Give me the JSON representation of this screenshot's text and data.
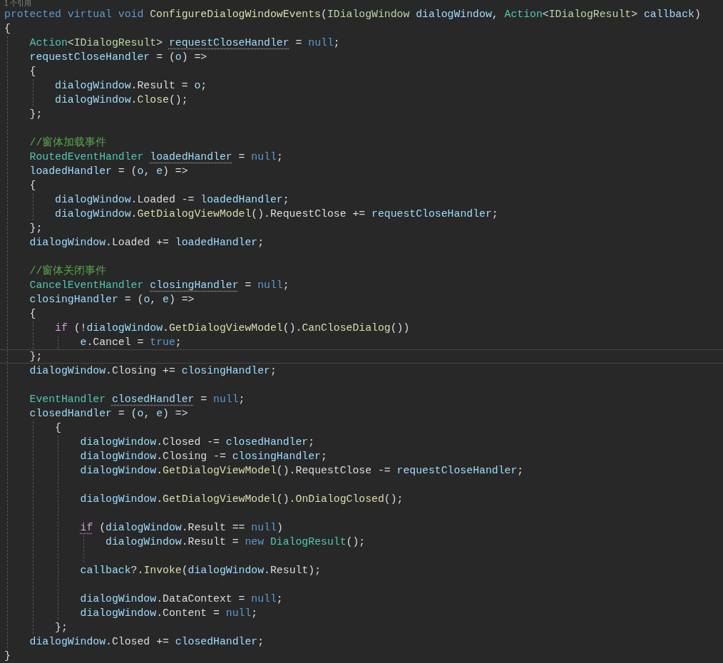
{
  "codelens": "1 个引用",
  "lines": [
    {
      "kind": "code",
      "current": false,
      "tokens": [
        {
          "kind": "kw",
          "text": "protected virtual void "
        },
        {
          "kind": "method",
          "text": "ConfigureDialogWindowEvents"
        },
        {
          "kind": "plain",
          "text": "("
        },
        {
          "kind": "iface",
          "text": "IDialogWindow "
        },
        {
          "kind": "var",
          "text": "dialogWindow"
        },
        {
          "kind": "plain",
          "text": ", "
        },
        {
          "kind": "type",
          "text": "Action"
        },
        {
          "kind": "plain",
          "text": "<"
        },
        {
          "kind": "iface",
          "text": "IDialogResult"
        },
        {
          "kind": "plain",
          "text": "> "
        },
        {
          "kind": "var",
          "text": "callback"
        },
        {
          "kind": "plain",
          "text": ")"
        }
      ]
    },
    {
      "kind": "code",
      "current": false,
      "tokens": [
        {
          "kind": "plain",
          "text": "{"
        }
      ]
    },
    {
      "kind": "code",
      "current": false,
      "tokens": [
        {
          "kind": "type",
          "text": "    Action"
        },
        {
          "kind": "plain",
          "text": "<"
        },
        {
          "kind": "iface",
          "text": "IDialogResult"
        },
        {
          "kind": "plain",
          "text": "> "
        },
        {
          "kind": "var",
          "text": "requestCloseHandler",
          "hint": true
        },
        {
          "kind": "plain",
          "text": " = "
        },
        {
          "kind": "kw",
          "text": "null"
        },
        {
          "kind": "plain",
          "text": ";"
        }
      ]
    },
    {
      "kind": "code",
      "current": false,
      "tokens": [
        {
          "kind": "var",
          "text": "    requestCloseHandler"
        },
        {
          "kind": "plain",
          "text": " = ("
        },
        {
          "kind": "var",
          "text": "o"
        },
        {
          "kind": "plain",
          "text": ") =>"
        }
      ]
    },
    {
      "kind": "code",
      "current": false,
      "tokens": [
        {
          "kind": "plain",
          "text": "    {"
        }
      ]
    },
    {
      "kind": "code",
      "current": false,
      "tokens": [
        {
          "kind": "var",
          "text": "        dialogWindow"
        },
        {
          "kind": "plain",
          "text": ".Result = "
        },
        {
          "kind": "var",
          "text": "o"
        },
        {
          "kind": "plain",
          "text": ";"
        }
      ]
    },
    {
      "kind": "code",
      "current": false,
      "tokens": [
        {
          "kind": "var",
          "text": "        dialogWindow"
        },
        {
          "kind": "plain",
          "text": "."
        },
        {
          "kind": "method",
          "text": "Close"
        },
        {
          "kind": "plain",
          "text": "();"
        }
      ]
    },
    {
      "kind": "code",
      "current": false,
      "tokens": [
        {
          "kind": "plain",
          "text": "    };"
        }
      ]
    },
    {
      "kind": "blank",
      "current": false
    },
    {
      "kind": "code",
      "current": false,
      "tokens": [
        {
          "kind": "comment",
          "text": "    //窗体加载事件"
        }
      ]
    },
    {
      "kind": "code",
      "current": false,
      "tokens": [
        {
          "kind": "type",
          "text": "    RoutedEventHandler "
        },
        {
          "kind": "var",
          "text": "loadedHandler",
          "hint": true
        },
        {
          "kind": "plain",
          "text": " = "
        },
        {
          "kind": "kw",
          "text": "null"
        },
        {
          "kind": "plain",
          "text": ";"
        }
      ]
    },
    {
      "kind": "code",
      "current": false,
      "tokens": [
        {
          "kind": "var",
          "text": "    loadedHandler"
        },
        {
          "kind": "plain",
          "text": " = ("
        },
        {
          "kind": "var",
          "text": "o"
        },
        {
          "kind": "plain",
          "text": ", "
        },
        {
          "kind": "var",
          "text": "e"
        },
        {
          "kind": "plain",
          "text": ") =>"
        }
      ]
    },
    {
      "kind": "code",
      "current": false,
      "tokens": [
        {
          "kind": "plain",
          "text": "    {"
        }
      ]
    },
    {
      "kind": "code",
      "current": false,
      "tokens": [
        {
          "kind": "var",
          "text": "        dialogWindow"
        },
        {
          "kind": "plain",
          "text": ".Loaded -= "
        },
        {
          "kind": "var",
          "text": "loadedHandler"
        },
        {
          "kind": "plain",
          "text": ";"
        }
      ]
    },
    {
      "kind": "code",
      "current": false,
      "tokens": [
        {
          "kind": "var",
          "text": "        dialogWindow"
        },
        {
          "kind": "plain",
          "text": "."
        },
        {
          "kind": "method",
          "text": "GetDialogViewModel"
        },
        {
          "kind": "plain",
          "text": "().RequestClose += "
        },
        {
          "kind": "var",
          "text": "requestCloseHandler"
        },
        {
          "kind": "plain",
          "text": ";"
        }
      ]
    },
    {
      "kind": "code",
      "current": false,
      "tokens": [
        {
          "kind": "plain",
          "text": "    };"
        }
      ]
    },
    {
      "kind": "code",
      "current": false,
      "tokens": [
        {
          "kind": "var",
          "text": "    dialogWindow"
        },
        {
          "kind": "plain",
          "text": ".Loaded += "
        },
        {
          "kind": "var",
          "text": "loadedHandler"
        },
        {
          "kind": "plain",
          "text": ";"
        }
      ]
    },
    {
      "kind": "blank",
      "current": false
    },
    {
      "kind": "code",
      "current": false,
      "tokens": [
        {
          "kind": "comment",
          "text": "    //窗体关闭事件"
        }
      ]
    },
    {
      "kind": "code",
      "current": false,
      "tokens": [
        {
          "kind": "type",
          "text": "    CancelEventHandler "
        },
        {
          "kind": "var",
          "text": "closingHandler",
          "hint": true
        },
        {
          "kind": "plain",
          "text": " = "
        },
        {
          "kind": "kw",
          "text": "null"
        },
        {
          "kind": "plain",
          "text": ";"
        }
      ]
    },
    {
      "kind": "code",
      "current": false,
      "tokens": [
        {
          "kind": "var",
          "text": "    closingHandler"
        },
        {
          "kind": "plain",
          "text": " = ("
        },
        {
          "kind": "var",
          "text": "o"
        },
        {
          "kind": "plain",
          "text": ", "
        },
        {
          "kind": "var",
          "text": "e"
        },
        {
          "kind": "plain",
          "text": ") =>"
        }
      ]
    },
    {
      "kind": "code",
      "current": false,
      "tokens": [
        {
          "kind": "plain",
          "text": "    {"
        }
      ]
    },
    {
      "kind": "code",
      "current": false,
      "tokens": [
        {
          "kind": "ctrl",
          "text": "        if"
        },
        {
          "kind": "plain",
          "text": " (!"
        },
        {
          "kind": "var",
          "text": "dialogWindow"
        },
        {
          "kind": "plain",
          "text": "."
        },
        {
          "kind": "method",
          "text": "GetDialogViewModel"
        },
        {
          "kind": "plain",
          "text": "()."
        },
        {
          "kind": "method",
          "text": "CanCloseDialog"
        },
        {
          "kind": "plain",
          "text": "())"
        }
      ]
    },
    {
      "kind": "code",
      "current": false,
      "tokens": [
        {
          "kind": "var",
          "text": "            e"
        },
        {
          "kind": "plain",
          "text": ".Cancel = "
        },
        {
          "kind": "kw",
          "text": "true"
        },
        {
          "kind": "plain",
          "text": ";"
        }
      ]
    },
    {
      "kind": "code",
      "current": true,
      "tokens": [
        {
          "kind": "plain",
          "text": "    };"
        }
      ]
    },
    {
      "kind": "code",
      "current": false,
      "tokens": [
        {
          "kind": "var",
          "text": "    dialogWindow"
        },
        {
          "kind": "plain",
          "text": ".Closing += "
        },
        {
          "kind": "var",
          "text": "closingHandler"
        },
        {
          "kind": "plain",
          "text": ";"
        }
      ]
    },
    {
      "kind": "blank",
      "current": false
    },
    {
      "kind": "code",
      "current": false,
      "tokens": [
        {
          "kind": "type",
          "text": "    EventHandler "
        },
        {
          "kind": "var",
          "text": "closedHandler",
          "hint": true
        },
        {
          "kind": "plain",
          "text": " = "
        },
        {
          "kind": "kw",
          "text": "null"
        },
        {
          "kind": "plain",
          "text": ";"
        }
      ]
    },
    {
      "kind": "code",
      "current": false,
      "tokens": [
        {
          "kind": "var",
          "text": "    closedHandler"
        },
        {
          "kind": "plain",
          "text": " = ("
        },
        {
          "kind": "var",
          "text": "o"
        },
        {
          "kind": "plain",
          "text": ", "
        },
        {
          "kind": "var",
          "text": "e"
        },
        {
          "kind": "plain",
          "text": ") =>"
        }
      ]
    },
    {
      "kind": "code",
      "current": false,
      "tokens": [
        {
          "kind": "plain",
          "text": "        {"
        }
      ]
    },
    {
      "kind": "code",
      "current": false,
      "tokens": [
        {
          "kind": "var",
          "text": "            dialogWindow"
        },
        {
          "kind": "plain",
          "text": ".Closed -= "
        },
        {
          "kind": "var",
          "text": "closedHandler"
        },
        {
          "kind": "plain",
          "text": ";"
        }
      ]
    },
    {
      "kind": "code",
      "current": false,
      "tokens": [
        {
          "kind": "var",
          "text": "            dialogWindow"
        },
        {
          "kind": "plain",
          "text": ".Closing -= "
        },
        {
          "kind": "var",
          "text": "closingHandler"
        },
        {
          "kind": "plain",
          "text": ";"
        }
      ]
    },
    {
      "kind": "code",
      "current": false,
      "tokens": [
        {
          "kind": "var",
          "text": "            dialogWindow"
        },
        {
          "kind": "plain",
          "text": "."
        },
        {
          "kind": "method",
          "text": "GetDialogViewModel"
        },
        {
          "kind": "plain",
          "text": "().RequestClose -= "
        },
        {
          "kind": "var",
          "text": "requestCloseHandler"
        },
        {
          "kind": "plain",
          "text": ";"
        }
      ]
    },
    {
      "kind": "blank",
      "current": false
    },
    {
      "kind": "code",
      "current": false,
      "tokens": [
        {
          "kind": "var",
          "text": "            dialogWindow"
        },
        {
          "kind": "plain",
          "text": "."
        },
        {
          "kind": "method",
          "text": "GetDialogViewModel"
        },
        {
          "kind": "plain",
          "text": "()."
        },
        {
          "kind": "method",
          "text": "OnDialogClosed"
        },
        {
          "kind": "plain",
          "text": "();"
        }
      ]
    },
    {
      "kind": "blank",
      "current": false
    },
    {
      "kind": "code",
      "current": false,
      "tokens": [
        {
          "kind": "ctrl",
          "text": "            if",
          "hint": true
        },
        {
          "kind": "plain",
          "text": " ("
        },
        {
          "kind": "var",
          "text": "dialogWindow"
        },
        {
          "kind": "plain",
          "text": ".Result == "
        },
        {
          "kind": "kw",
          "text": "null"
        },
        {
          "kind": "plain",
          "text": ")"
        }
      ]
    },
    {
      "kind": "code",
      "current": false,
      "tokens": [
        {
          "kind": "var",
          "text": "                dialogWindow"
        },
        {
          "kind": "plain",
          "text": ".Result = "
        },
        {
          "kind": "kw",
          "text": "new "
        },
        {
          "kind": "type",
          "text": "DialogResult"
        },
        {
          "kind": "plain",
          "text": "();"
        }
      ]
    },
    {
      "kind": "blank",
      "current": false
    },
    {
      "kind": "code",
      "current": false,
      "tokens": [
        {
          "kind": "var",
          "text": "            callback"
        },
        {
          "kind": "plain",
          "text": "?."
        },
        {
          "kind": "method",
          "text": "Invoke"
        },
        {
          "kind": "plain",
          "text": "("
        },
        {
          "kind": "var",
          "text": "dialogWindow"
        },
        {
          "kind": "plain",
          "text": ".Result);"
        }
      ]
    },
    {
      "kind": "blank",
      "current": false
    },
    {
      "kind": "code",
      "current": false,
      "tokens": [
        {
          "kind": "var",
          "text": "            dialogWindow"
        },
        {
          "kind": "plain",
          "text": ".DataContext = "
        },
        {
          "kind": "kw",
          "text": "null"
        },
        {
          "kind": "plain",
          "text": ";"
        }
      ]
    },
    {
      "kind": "code",
      "current": false,
      "tokens": [
        {
          "kind": "var",
          "text": "            dialogWindow"
        },
        {
          "kind": "plain",
          "text": ".Content = "
        },
        {
          "kind": "kw",
          "text": "null"
        },
        {
          "kind": "plain",
          "text": ";"
        }
      ]
    },
    {
      "kind": "code",
      "current": false,
      "tokens": [
        {
          "kind": "plain",
          "text": "        };"
        }
      ]
    },
    {
      "kind": "code",
      "current": false,
      "tokens": [
        {
          "kind": "var",
          "text": "    dialogWindow"
        },
        {
          "kind": "plain",
          "text": ".Closed += "
        },
        {
          "kind": "var",
          "text": "closedHandler"
        },
        {
          "kind": "plain",
          "text": ";"
        }
      ]
    },
    {
      "kind": "code",
      "current": false,
      "tokens": [
        {
          "kind": "plain",
          "text": "}"
        }
      ]
    }
  ]
}
